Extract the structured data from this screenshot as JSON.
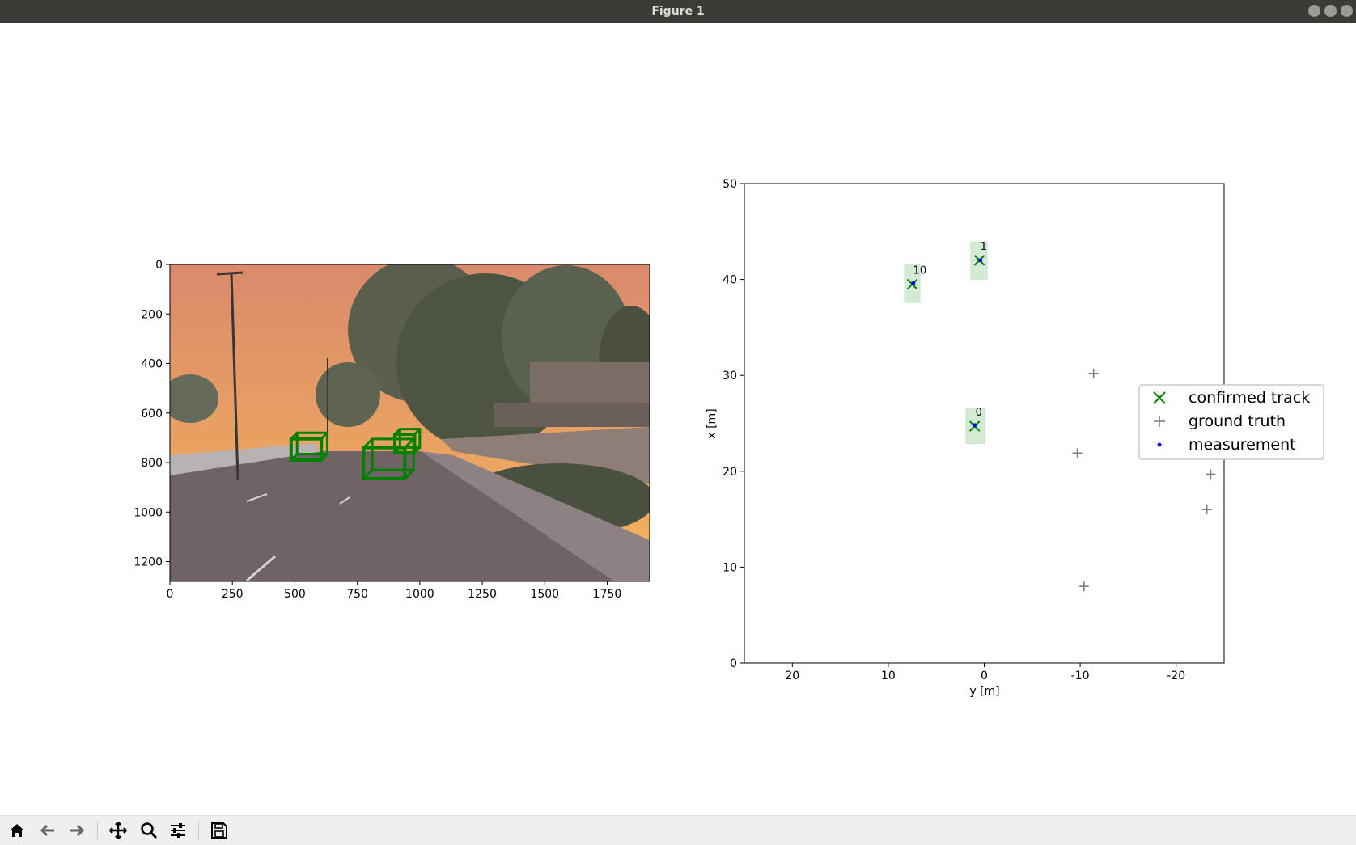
{
  "window": {
    "title": "Figure 1"
  },
  "toolbar": {
    "buttons": [
      {
        "name": "home-icon"
      },
      {
        "name": "back-arrow-icon"
      },
      {
        "name": "forward-arrow-icon"
      },
      {
        "name": "pan-icon"
      },
      {
        "name": "zoom-icon"
      },
      {
        "name": "subplots-config-icon"
      },
      {
        "name": "save-icon"
      }
    ]
  },
  "colors": {
    "track": "#008000",
    "track_box": "#c8e6c9",
    "ground_truth": "#808080",
    "measurement": "#0000ff",
    "titlebar": "#3c3b37",
    "sky_top": "#d98a6c",
    "sky_bottom": "#f6b45a",
    "road": "#6f6366"
  },
  "chart_data": [
    {
      "type": "image",
      "x_ticks": [
        0,
        250,
        500,
        750,
        1000,
        1250,
        1500,
        1750
      ],
      "y_ticks": [
        0,
        200,
        400,
        600,
        800,
        1000,
        1200
      ],
      "xlim": [
        0,
        1920
      ],
      "ylim": [
        1280,
        0
      ],
      "boxes_3d": [
        {
          "x": [
            485,
            630
          ],
          "y": [
            680,
            790
          ]
        },
        {
          "x": [
            775,
            975
          ],
          "y": [
            705,
            865
          ]
        },
        {
          "x": [
            900,
            1000
          ],
          "y": [
            665,
            760
          ]
        }
      ]
    },
    {
      "type": "scatter",
      "xlabel": "y [m]",
      "ylabel": "x [m]",
      "xlim": [
        25,
        -25
      ],
      "ylim": [
        0,
        50
      ],
      "x_ticks": [
        20,
        10,
        0,
        -10,
        -20
      ],
      "y_ticks": [
        0,
        10,
        20,
        30,
        40,
        50
      ],
      "series": [
        {
          "name": "confirmed track",
          "points": [
            {
              "y": 7.5,
              "x": 39.5,
              "label": "10"
            },
            {
              "y": 0.5,
              "x": 42.0,
              "label": "1"
            },
            {
              "y": 1.0,
              "x": 24.7,
              "label": "0"
            }
          ]
        },
        {
          "name": "ground truth",
          "points": [
            {
              "y": -11.4,
              "x": 30.2
            },
            {
              "y": -9.7,
              "x": 21.9
            },
            {
              "y": -23.6,
              "x": 19.7
            },
            {
              "y": -23.2,
              "x": 16.0
            },
            {
              "y": -10.4,
              "x": 8.0
            }
          ]
        },
        {
          "name": "measurement",
          "points": [
            {
              "y": 7.4,
              "x": 39.6
            },
            {
              "y": 0.4,
              "x": 42.0
            },
            {
              "y": 1.0,
              "x": 24.8
            }
          ]
        }
      ],
      "track_boxes": [
        {
          "y": [
            6.7,
            8.3
          ],
          "x": [
            37.6,
            41.6
          ]
        },
        {
          "y": [
            -0.3,
            1.4
          ],
          "x": [
            40.0,
            43.9
          ]
        },
        {
          "y": [
            0.0,
            1.9
          ],
          "x": [
            22.9,
            26.6
          ]
        }
      ],
      "legend": {
        "position": "right",
        "entries": [
          "confirmed track",
          "ground truth",
          "measurement"
        ]
      }
    }
  ]
}
